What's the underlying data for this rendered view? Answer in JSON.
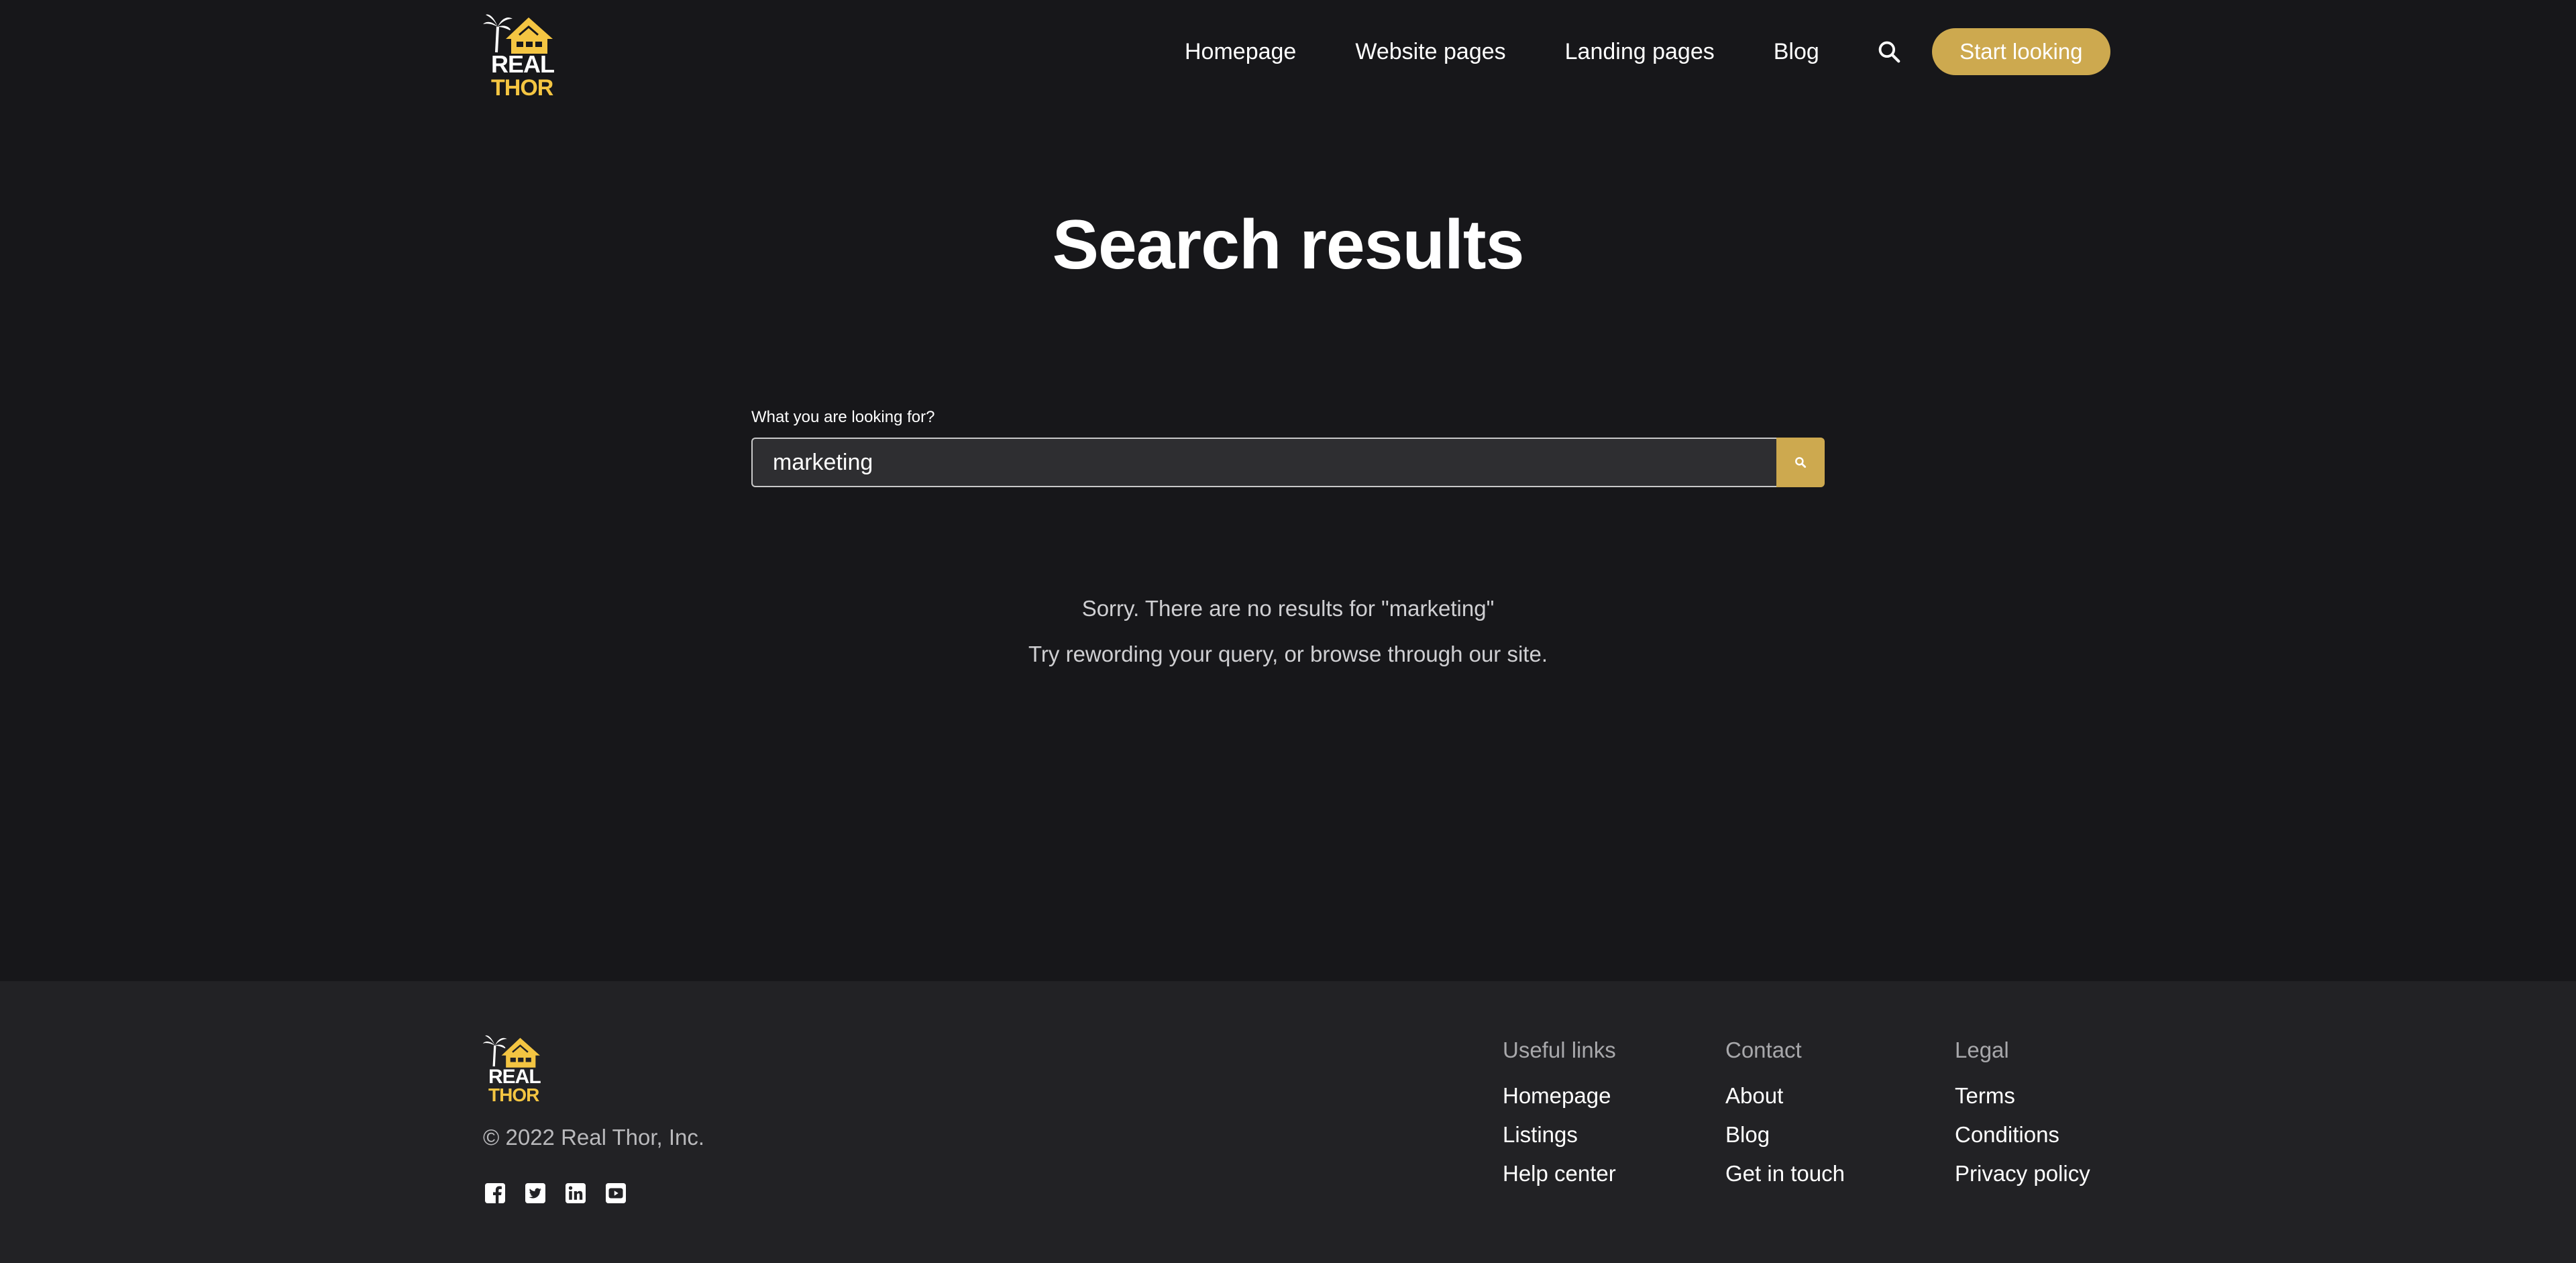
{
  "header": {
    "logo": {
      "line1": "REAL",
      "line2": "THOR"
    },
    "nav": [
      "Homepage",
      "Website pages",
      "Landing pages",
      "Blog"
    ],
    "cta": "Start looking"
  },
  "main": {
    "title": "Search results",
    "search_label": "What you are looking for?",
    "search_value": "marketing",
    "no_results": "Sorry. There are no results for \"marketing\"",
    "hint": "Try rewording your query, or browse through our site."
  },
  "footer": {
    "logo": {
      "line1": "REAL",
      "line2": "THOR"
    },
    "copyright": "© 2022 Real Thor, Inc.",
    "social": [
      "facebook-icon",
      "twitter-icon",
      "linkedin-icon",
      "youtube-icon"
    ],
    "columns": [
      {
        "title": "Useful links",
        "links": [
          "Homepage",
          "Listings",
          "Help center"
        ]
      },
      {
        "title": "Contact",
        "links": [
          "About",
          "Blog",
          "Get in touch"
        ]
      },
      {
        "title": "Legal",
        "links": [
          "Terms",
          "Conditions",
          "Privacy policy"
        ]
      }
    ]
  },
  "colors": {
    "background": "#17171a",
    "footer": "#222225",
    "accent": "#cda94f"
  }
}
